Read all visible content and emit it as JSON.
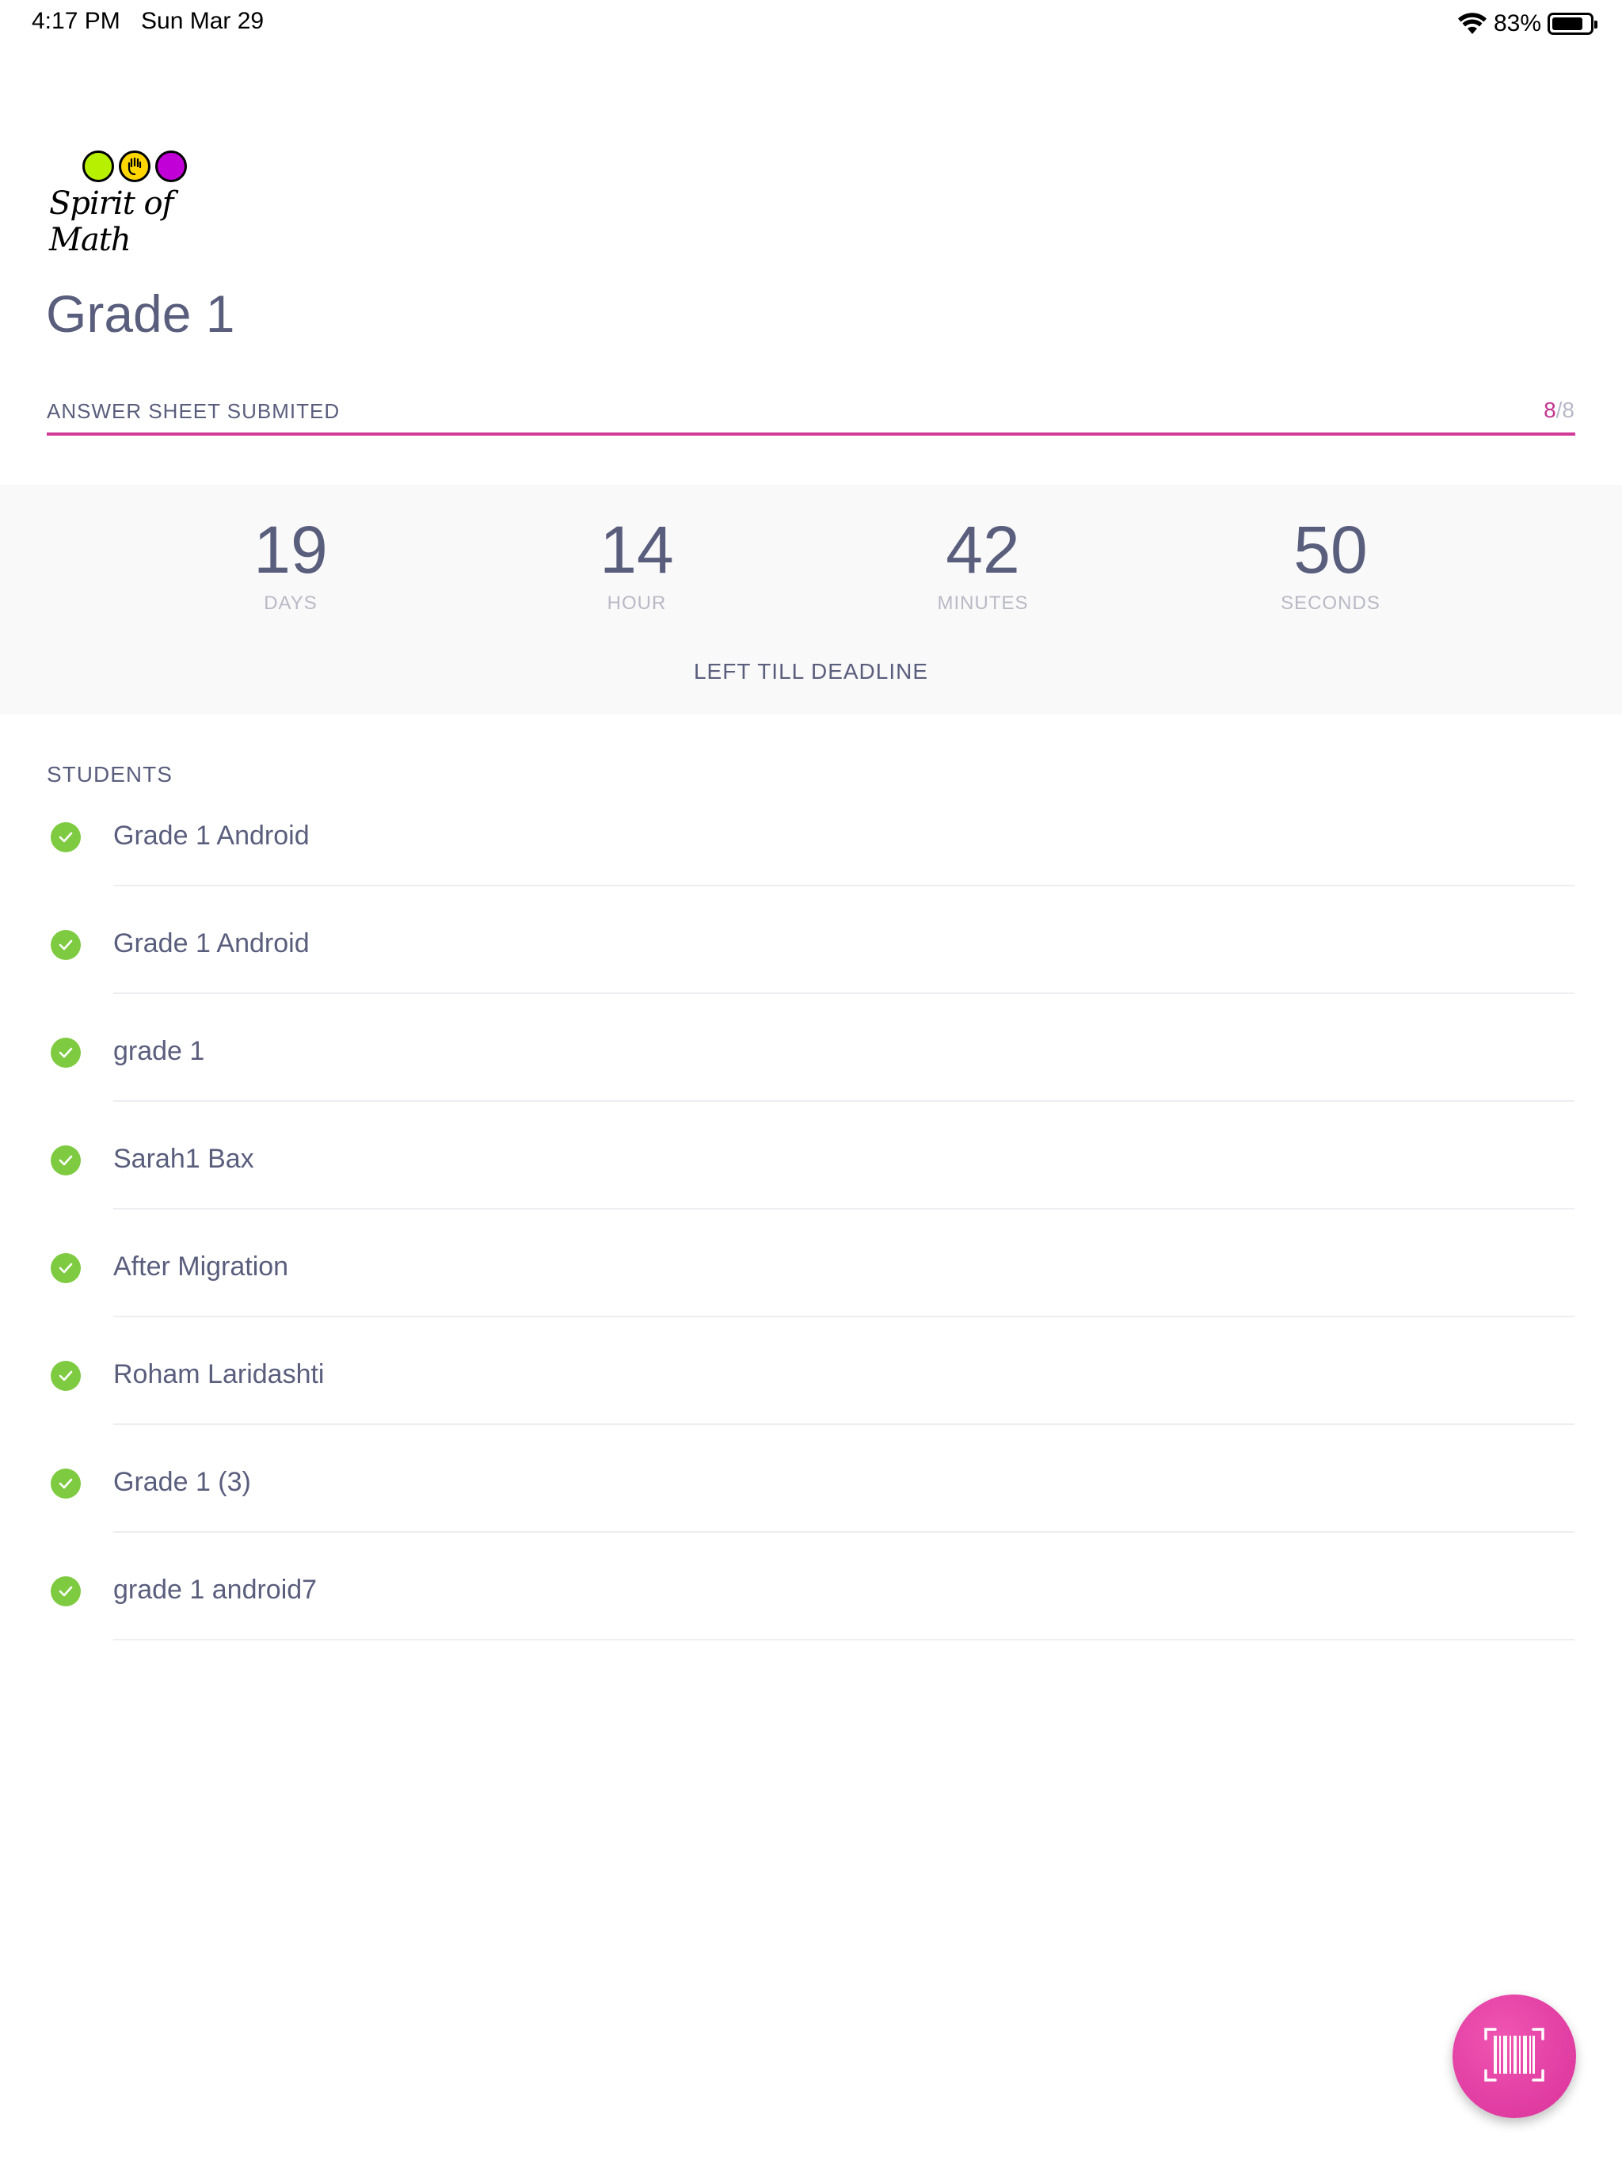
{
  "status_bar": {
    "time": "4:17 PM",
    "date": "Sun Mar 29",
    "battery_percent": "83%",
    "battery_level": 0.83,
    "icons": [
      "wifi-icon",
      "battery-icon"
    ]
  },
  "brand": {
    "logo_text": "Spirit of Math",
    "dot_colors": [
      "#b7f000",
      "#ffd600",
      "#c000d6"
    ]
  },
  "header": {
    "title": "Grade 1"
  },
  "progress": {
    "label": "ANSWER SHEET SUBMITED",
    "current": "8",
    "total": "8",
    "fraction": 1.0,
    "accent_color": "#d13a98"
  },
  "countdown": {
    "units": [
      {
        "value": "19",
        "label": "DAYS"
      },
      {
        "value": "14",
        "label": "HOUR"
      },
      {
        "value": "42",
        "label": "MINUTES"
      },
      {
        "value": "50",
        "label": "SECONDS"
      }
    ],
    "caption": "LEFT TILL DEADLINE"
  },
  "students": {
    "heading": "STUDENTS",
    "items": [
      {
        "name": "Grade 1 Android",
        "status": "submitted"
      },
      {
        "name": "Grade 1 Android",
        "status": "submitted"
      },
      {
        "name": "grade 1",
        "status": "submitted"
      },
      {
        "name": "Sarah1 Bax",
        "status": "submitted"
      },
      {
        "name": "After Migration",
        "status": "submitted"
      },
      {
        "name": "Roham Laridashti",
        "status": "submitted"
      },
      {
        "name": "Grade 1 (3)",
        "status": "submitted"
      },
      {
        "name": "grade 1 android7",
        "status": "submitted"
      }
    ],
    "check_color": "#7ecb41"
  },
  "fab": {
    "icon": "barcode-scan-icon",
    "color": "#e03fa3"
  }
}
